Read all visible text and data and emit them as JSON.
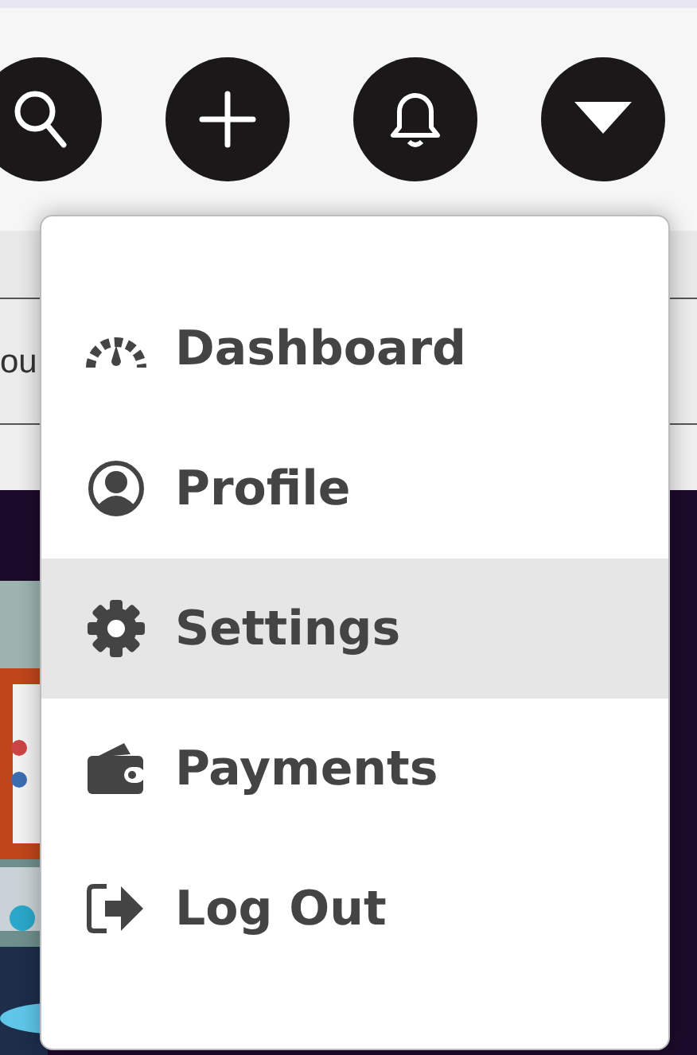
{
  "toolbar": [
    {
      "kind": "search"
    },
    {
      "kind": "add"
    },
    {
      "kind": "bell"
    },
    {
      "kind": "caret"
    }
  ],
  "background": {
    "field_text": "ou"
  },
  "menu": {
    "items": [
      {
        "label": "Dashboard",
        "kind": "gauge",
        "selected": false
      },
      {
        "label": "Profile",
        "kind": "user",
        "selected": false
      },
      {
        "label": "Settings",
        "kind": "gear",
        "selected": true
      },
      {
        "label": "Payments",
        "kind": "wallet",
        "selected": false
      },
      {
        "label": "Log Out",
        "kind": "logout",
        "selected": false
      }
    ]
  }
}
